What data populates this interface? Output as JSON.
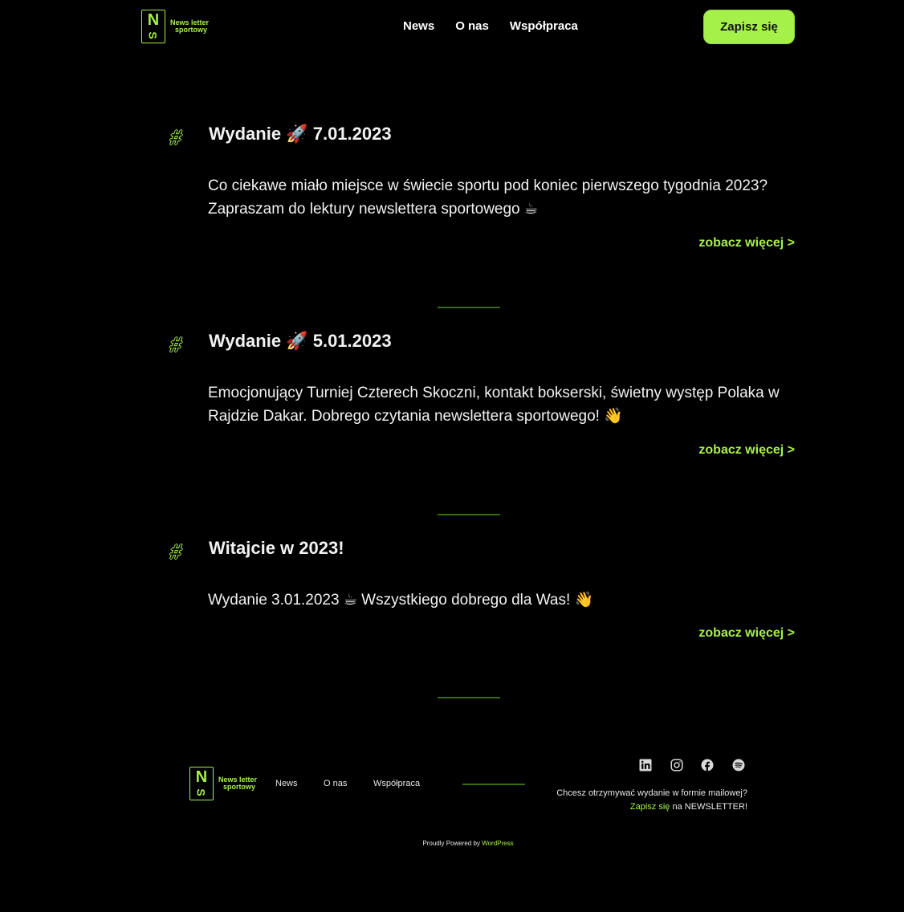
{
  "header": {
    "logo": {
      "mark_letter": "N",
      "mark_sub": "S",
      "text_line1": "News letter",
      "text_line2": "sportowy"
    },
    "nav": [
      "News",
      "O nas",
      "Współpraca"
    ],
    "cta_label": "Zapisz się"
  },
  "posts": [
    {
      "title_prefix": "Wydanie",
      "title_emoji": "🚀",
      "title_date": "7.01.2023",
      "excerpt": "Co ciekawe miało miejsce w świecie sportu pod koniec pierwszego tygodnia 2023? Zapraszam do lektury newslettera sportowego ☕",
      "more": "zobacz więcej >"
    },
    {
      "title_prefix": "Wydanie",
      "title_emoji": "🚀",
      "title_date": "5.01.2023",
      "excerpt": "Emocjonujący Turniej Czterech Skoczni, kontakt bokserski, świetny występ Polaka w Rajdzie Dakar. Dobrego czytania newslettera sportowego! 👋",
      "more": "zobacz więcej >"
    },
    {
      "title": "Witajcie w 2023!",
      "excerpt": "Wydanie 3.01.2023 ☕ Wszystkiego dobrego dla Was! 👋",
      "more": "zobacz więcej >"
    }
  ],
  "hash_symbol": "#",
  "footer": {
    "nav": [
      "News",
      "O nas",
      "Współpraca"
    ],
    "social_icons": [
      "linkedin-icon",
      "instagram-icon",
      "facebook-icon",
      "spotify-icon"
    ],
    "signup_question": "Chcesz otrzymywać wydanie w formie mailowej?",
    "signup_link": "Zapisz się",
    "signup_rest": " na NEWSLETTER!",
    "powered_prefix": "Proudly Powered by ",
    "powered_link": "WordPress"
  },
  "colors": {
    "accent": "#a6f04a",
    "background": "#000000",
    "divider": "#3b6a14"
  }
}
